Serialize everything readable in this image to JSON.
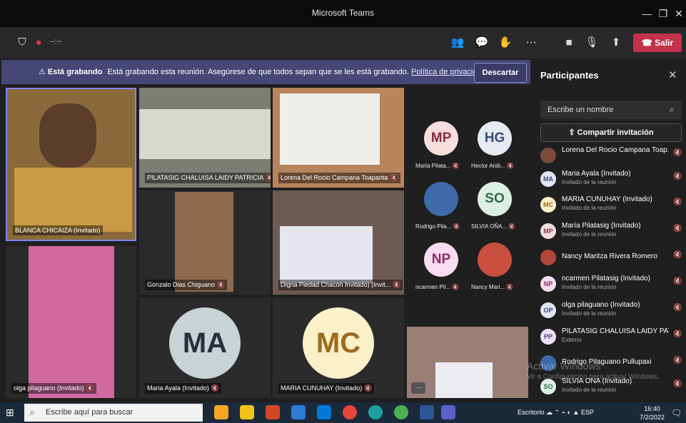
{
  "window": {
    "title": "Microsoft Teams"
  },
  "toolbar": {
    "timer": "--:--",
    "leave_label": "Salir"
  },
  "banner": {
    "title": "Está grabando",
    "message": "Está grabando esta reunión. Asegúrese de que todos sepan que se les está grabando.",
    "link": "Política de privacidad",
    "dismiss_label": "Descartar"
  },
  "video_tiles": [
    {
      "label": "BLANCA CHICAIZA (Invitado)"
    },
    {
      "label": "PILATASIG CHALUISA LAIDY PATRICIA"
    },
    {
      "label": "Lorena Del Rocio Campana Toapanta"
    },
    {
      "label": "Gonzalo Dias Chiguano"
    },
    {
      "label": "Digna Piedad Chacon Invitado) (Invit..."
    },
    {
      "label": "olga pilaguano (Invitado)"
    },
    {
      "label": "Maria Ayala (Invitado)",
      "initials": "MA"
    },
    {
      "label": "MARIA CUNUHAY (Invitado)",
      "initials": "MC"
    }
  ],
  "small_tiles": [
    {
      "initials": "MP",
      "label": "María Pilata..."
    },
    {
      "initials": "HG",
      "label": "Hector Anib..."
    },
    {
      "initials": "",
      "label": "Rodrigo Pila..."
    },
    {
      "initials": "SO",
      "label": "SILVIA OÑA..."
    },
    {
      "initials": "NP",
      "label": "ncarmen Pil..."
    },
    {
      "initials": "",
      "label": "Nancy Mari..."
    }
  ],
  "panel": {
    "title": "Participantes",
    "search_placeholder": "Escribe un nombre",
    "share_label": "Compartir invitación",
    "participants": [
      {
        "initials": "",
        "name": "Lorena Del Rocio Campana Toap...",
        "sub": ""
      },
      {
        "initials": "MA",
        "name": "Maria Ayala (Invitado)",
        "sub": "Invitado de la reunión"
      },
      {
        "initials": "MC",
        "name": "MARIA CUNUHAY (Invitado)",
        "sub": "Invitado de la reunión"
      },
      {
        "initials": "MP",
        "name": "María Pilatasig (Invitado)",
        "sub": "Invitado de la reunión"
      },
      {
        "initials": "",
        "name": "Nancy Maritza Rivera Romero",
        "sub": ""
      },
      {
        "initials": "NP",
        "name": "ncarmen Pilatasig (Invitado)",
        "sub": "Invitado de la reunión"
      },
      {
        "initials": "OP",
        "name": "olga pilaguano (Invitado)",
        "sub": "Invitado de la reunión"
      },
      {
        "initials": "PP",
        "name": "PILATASIG CHALUISA LAIDY PAT...",
        "sub": "Externo"
      },
      {
        "initials": "",
        "name": "Rodrigo Pilaguano Pullupaxi",
        "sub": ""
      },
      {
        "initials": "SO",
        "name": "SILVIA OÑA (Invitado)",
        "sub": "Invitado de la reunión"
      }
    ]
  },
  "watermark": {
    "line1": "Activar Windows",
    "line2": "Ve a Configuración para activar Windows."
  },
  "taskbar": {
    "search_placeholder": "Escribe aquí para buscar",
    "tray_label": "Escritorio",
    "lang": "ESP",
    "time": "16:40",
    "date": "7/2/2022"
  }
}
